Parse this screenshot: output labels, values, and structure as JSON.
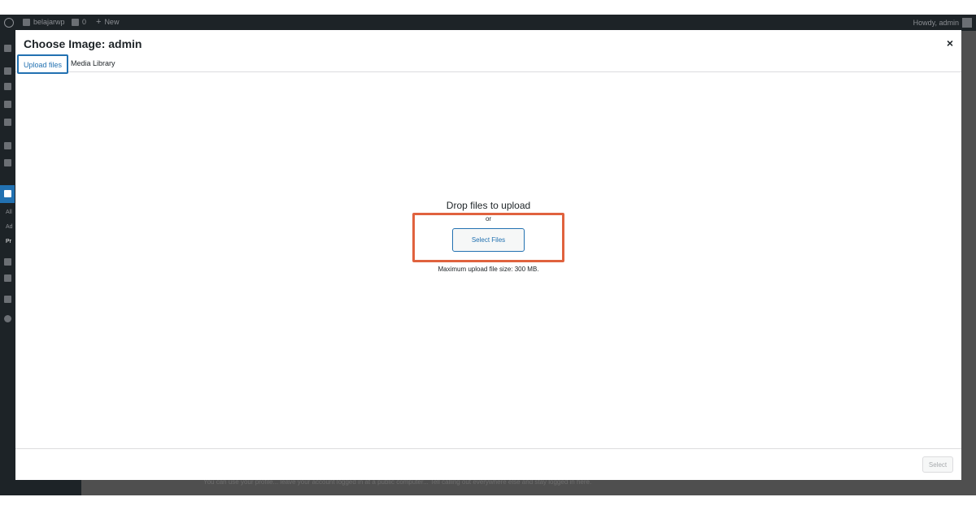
{
  "adminbar": {
    "site_name": "belajarwp",
    "comments_count": "0",
    "new_label": "New",
    "howdy": "Howdy, admin"
  },
  "sidebar": {
    "sub_items": [
      "All",
      "Ad",
      "Pr"
    ]
  },
  "background": {
    "hint_text": "You can use your profile... leave your account logged in at a public computer... Tell calling out everywhere else and stay logged in here."
  },
  "modal": {
    "title": "Choose Image: admin",
    "close_label": "×",
    "tabs": [
      {
        "label": "Upload files",
        "active": true
      },
      {
        "label": "Media Library",
        "active": false
      }
    ],
    "upload": {
      "drop_title": "Drop files to upload",
      "or_text": "or",
      "select_files_label": "Select Files",
      "max_size_text": "Maximum upload file size: 300 MB."
    },
    "toolbar": {
      "select_label": "Select"
    }
  },
  "colors": {
    "accent": "#2271b1",
    "highlight": "#e0623e",
    "admin_dark": "#1d2327"
  }
}
